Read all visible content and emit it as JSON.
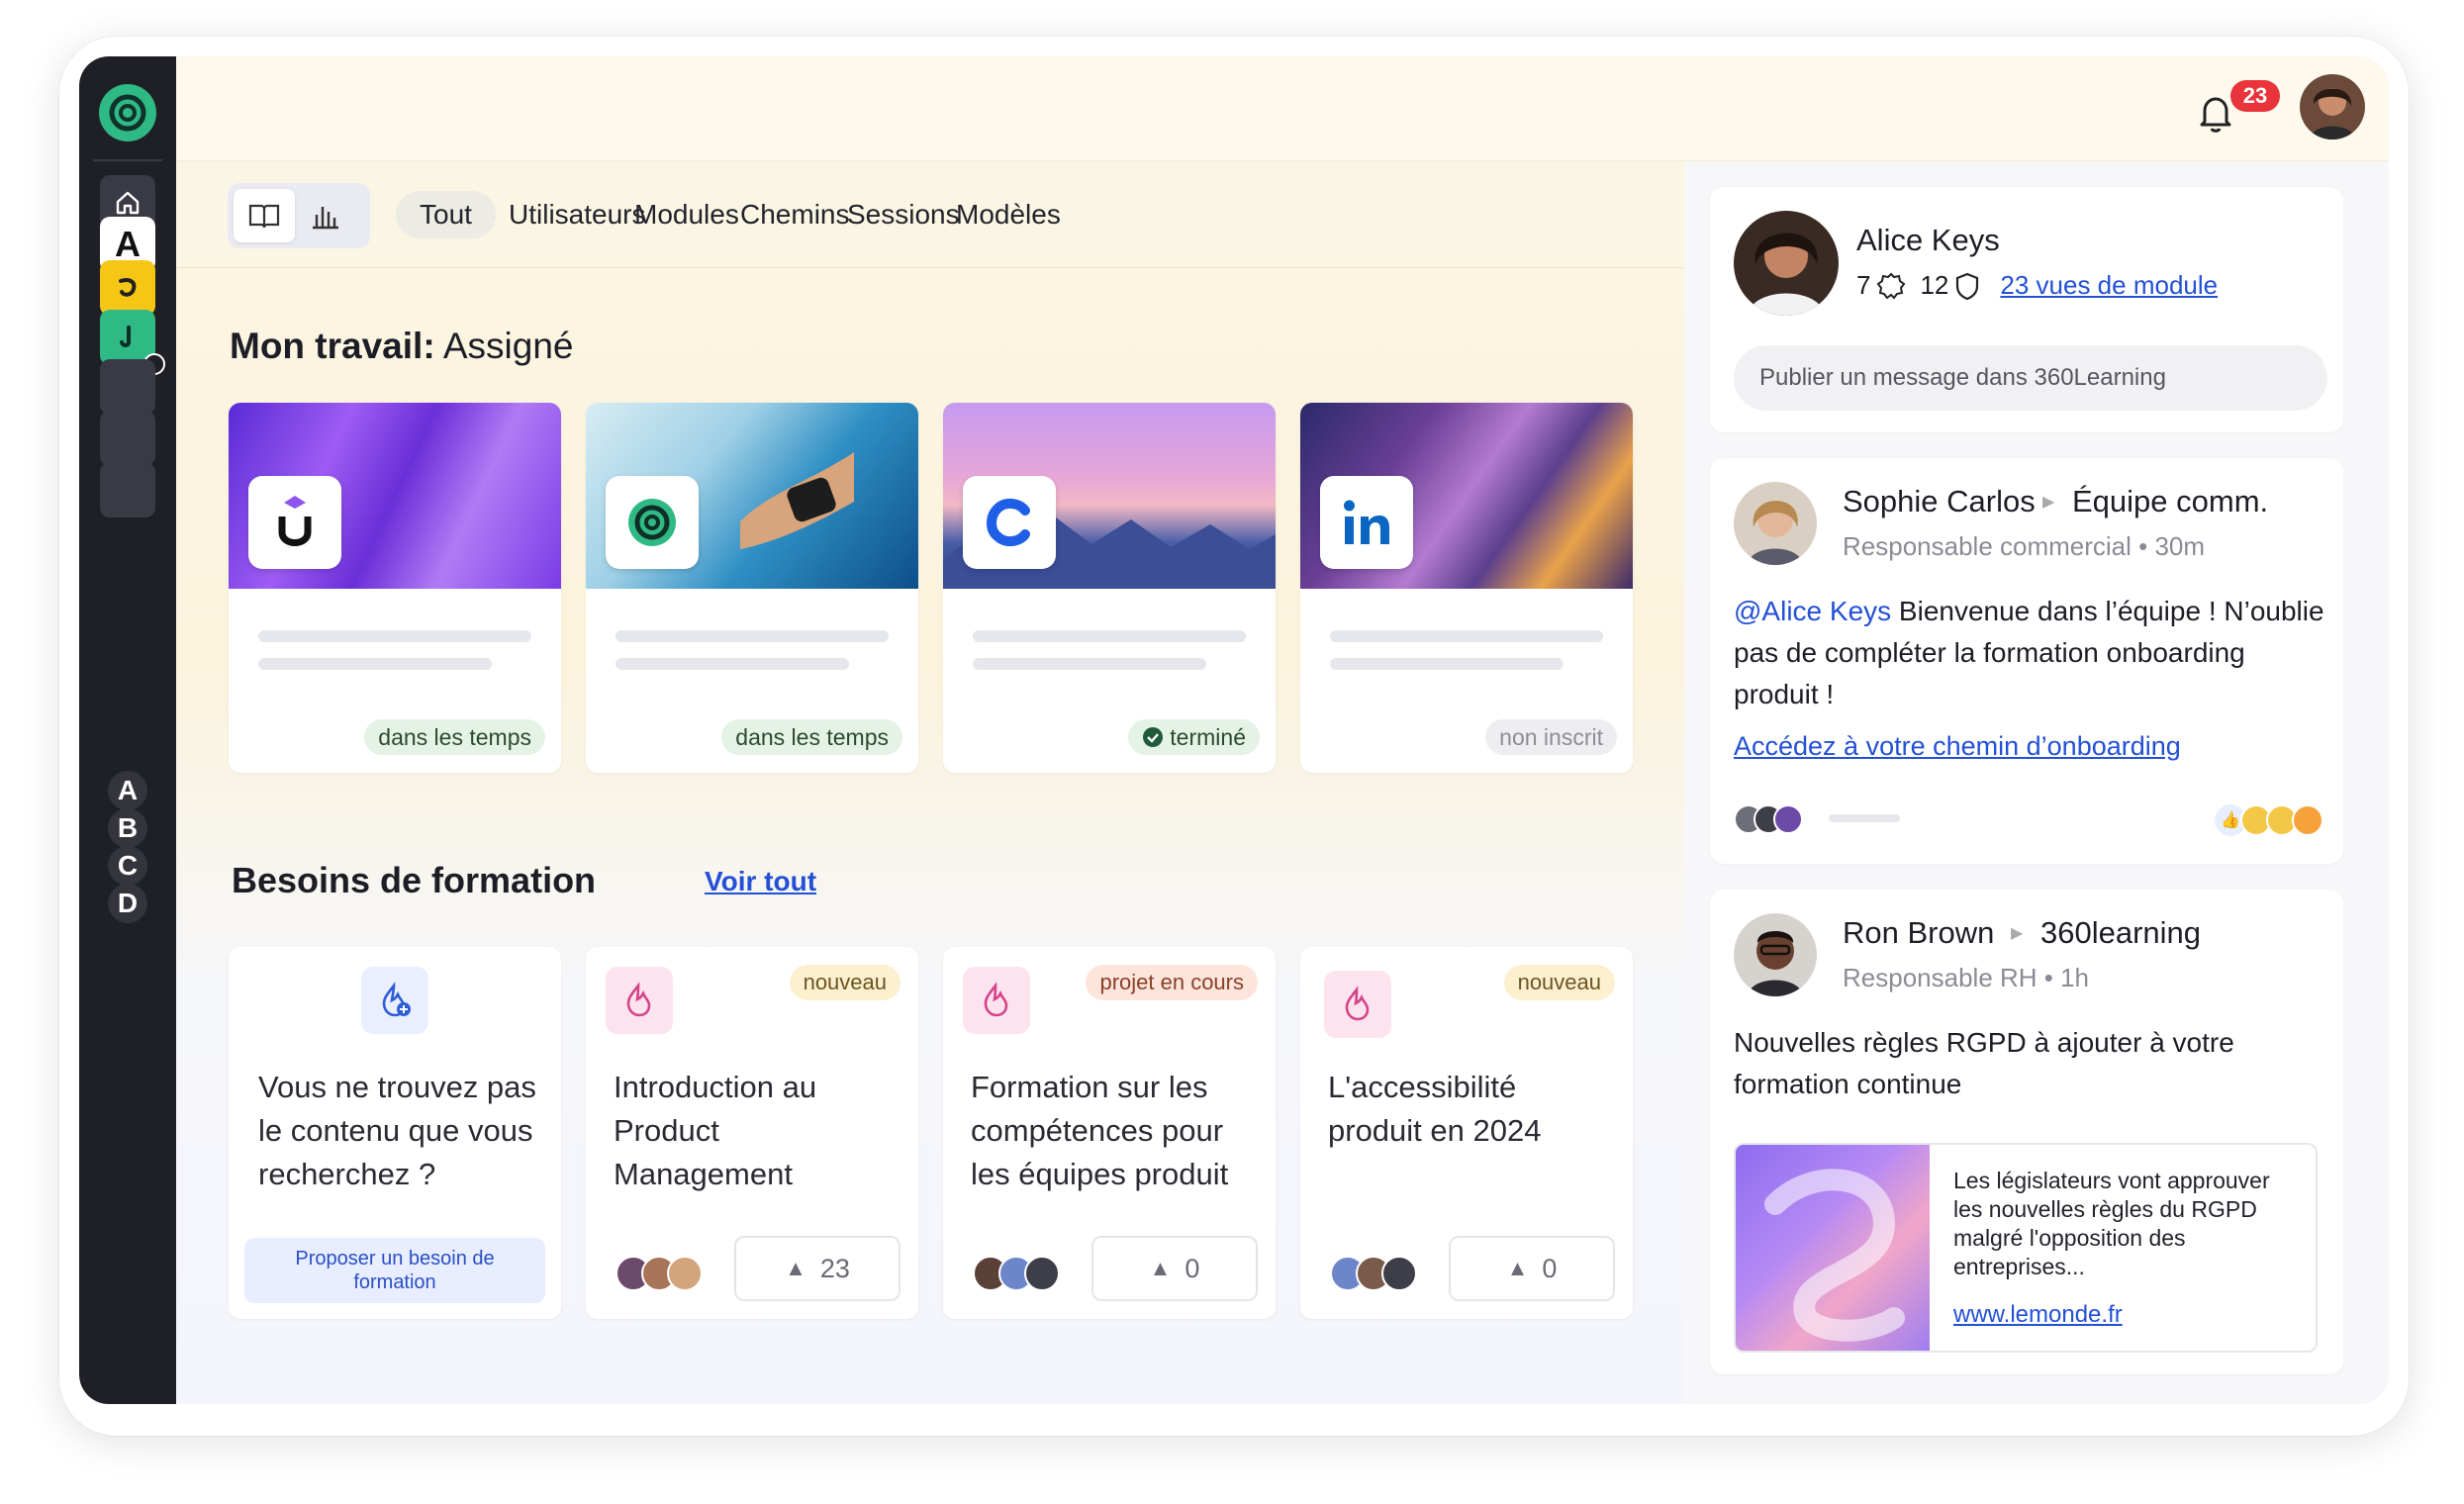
{
  "topbar": {
    "notification_count": "23",
    "bell_icon": "bell-icon"
  },
  "rail": {
    "letters": [
      "A",
      "B",
      "C",
      "D"
    ],
    "app_letter": "A"
  },
  "tabs": {
    "items": [
      "Tout",
      "Utilisateurs",
      "Modules",
      "Chemins",
      "Sessions",
      "Modèles"
    ],
    "active": "Tout"
  },
  "my_work": {
    "title_bold": "Mon travail:",
    "title_rest": " Assigné",
    "cards": [
      {
        "logo": "U",
        "status": "dans les temps"
      },
      {
        "logo": "360",
        "status": "dans les temps"
      },
      {
        "logo": "C",
        "status": "terminé"
      },
      {
        "logo": "in",
        "status": "non inscrit"
      }
    ]
  },
  "needs": {
    "title": "Besoins de formation",
    "see_all": "Voir tout",
    "propose_card": {
      "text": "Vous ne trouvez pas le contenu que vous recherchez ?",
      "button": "Proposer un besoin de formation"
    },
    "cards": [
      {
        "tag": "nouveau",
        "text": "Introduction au Product Management",
        "votes": "23"
      },
      {
        "tag": "projet en cours",
        "text": "Formation sur les compétences pour les équipes produit",
        "votes": "0"
      },
      {
        "tag": "nouveau",
        "text": "L'accessibilité produit en 2024",
        "votes": "0"
      }
    ]
  },
  "profile": {
    "name": "Alice Keys",
    "stat1": "7",
    "stat2": "12",
    "views": "23 vues de module",
    "post_placeholder": "Publier un message dans 360Learning"
  },
  "feed": [
    {
      "author": "Sophie Carlos",
      "target": "Équipe comm.",
      "role": "Responsable commercial • 30m",
      "mention": "@Alice Keys",
      "body": " Bienvenue dans l’équipe ! N’oublie pas de compléter la formation onboarding produit !",
      "link": "Accédez à votre chemin d’onboarding"
    },
    {
      "author": "Ron Brown",
      "target": "360learning",
      "role": "Responsable RH • 1h",
      "body": "Nouvelles règles RGPD à ajouter à votre formation continue",
      "preview_text": "Les législateurs vont approuver les nouvelles règles du RGPD malgré l'opposition des entreprises...",
      "preview_link": "www.lemonde.fr"
    }
  ],
  "colors": {
    "accent": "#2fb985",
    "link": "#2350d6",
    "badge": "#e8343a"
  }
}
